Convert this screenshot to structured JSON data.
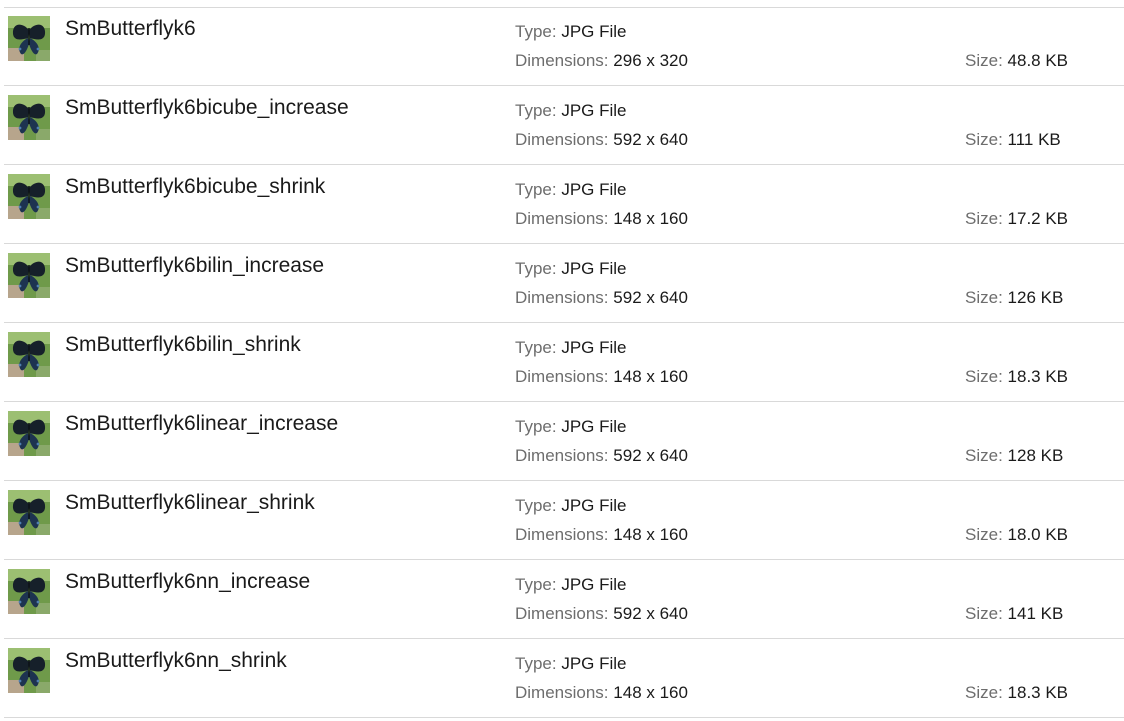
{
  "labels": {
    "type": "Type:",
    "dimensions": "Dimensions:",
    "size": "Size:"
  },
  "thumbnail_icon": "butterfly-photo-thumbnail",
  "files": [
    {
      "name": "SmButterflyk6",
      "type": "JPG File",
      "dimensions": "296 x 320",
      "size": "48.8 KB"
    },
    {
      "name": "SmButterflyk6bicube_increase",
      "type": "JPG File",
      "dimensions": "592 x 640",
      "size": "111 KB"
    },
    {
      "name": "SmButterflyk6bicube_shrink",
      "type": "JPG File",
      "dimensions": "148 x 160",
      "size": "17.2 KB"
    },
    {
      "name": "SmButterflyk6bilin_increase",
      "type": "JPG File",
      "dimensions": "592 x 640",
      "size": "126 KB"
    },
    {
      "name": "SmButterflyk6bilin_shrink",
      "type": "JPG File",
      "dimensions": "148 x 160",
      "size": "18.3 KB"
    },
    {
      "name": "SmButterflyk6linear_increase",
      "type": "JPG File",
      "dimensions": "592 x 640",
      "size": "128 KB"
    },
    {
      "name": "SmButterflyk6linear_shrink",
      "type": "JPG File",
      "dimensions": "148 x 160",
      "size": "18.0 KB"
    },
    {
      "name": "SmButterflyk6nn_increase",
      "type": "JPG File",
      "dimensions": "592 x 640",
      "size": "141 KB"
    },
    {
      "name": "SmButterflyk6nn_shrink",
      "type": "JPG File",
      "dimensions": "148 x 160",
      "size": "18.3 KB"
    }
  ]
}
